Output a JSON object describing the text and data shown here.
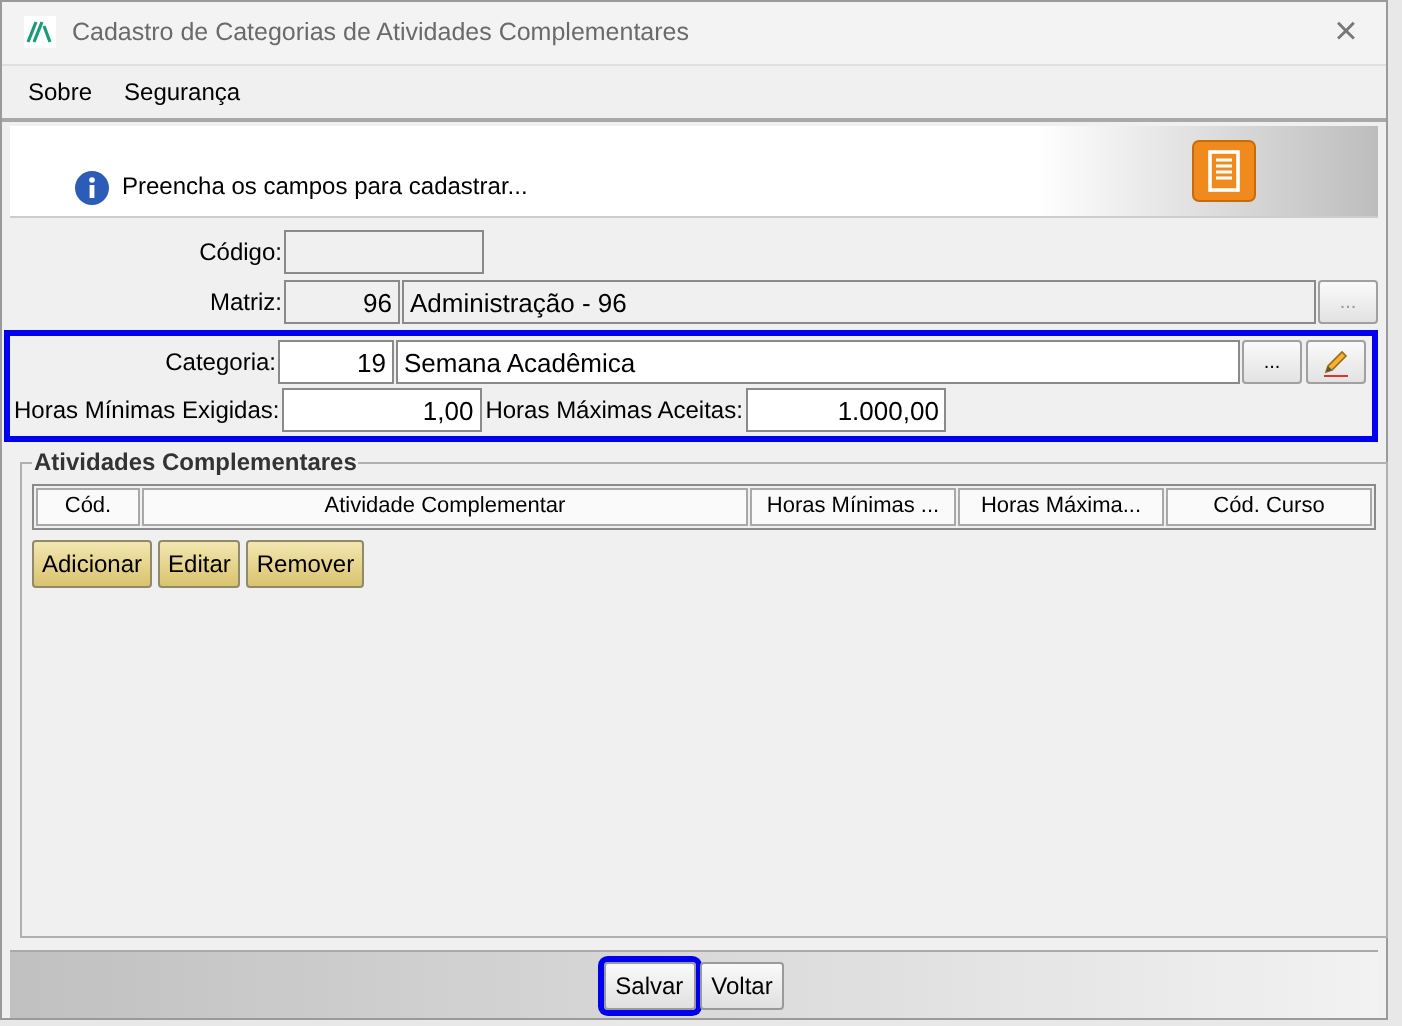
{
  "window": {
    "title": "Cadastro de Categorias de Atividades Complementares",
    "close": "×"
  },
  "menu": [
    {
      "label": "Sobre"
    },
    {
      "label": "Segurança"
    }
  ],
  "header": {
    "message": "Preencha os campos para cadastrar..."
  },
  "form": {
    "codigo": {
      "label": "Código:"
    },
    "matriz": {
      "label": "Matriz:",
      "code": "96",
      "name": "Administração - 96",
      "button": "..."
    },
    "categoria_group": {
      "focused": true,
      "categoria": {
        "label": "Categoria:",
        "code": "19",
        "name": "Semana Acadêmica",
        "button": "..."
      },
      "horas_minimas": {
        "label": "Horas Mínimas Exigidas:",
        "value": "1,00"
      },
      "horas_maximas": {
        "label": "Horas Máximas Aceitas:",
        "value": "1.000,00"
      }
    }
  },
  "activities": {
    "title": "Atividades Complementares",
    "table": {
      "columns": [
        "Cód.",
        "Atividade Complementar",
        "Horas Mínimas ...",
        "Horas Máxima...",
        "Cód. Curso"
      ]
    },
    "buttons": [
      {
        "label": "Adicionar"
      },
      {
        "label": "Editar"
      },
      {
        "label": "Remover"
      }
    ]
  },
  "footer": {
    "buttons": [
      {
        "label": "Salvar",
        "focused": true
      },
      {
        "label": "Voltar",
        "focused": false
      }
    ]
  }
}
